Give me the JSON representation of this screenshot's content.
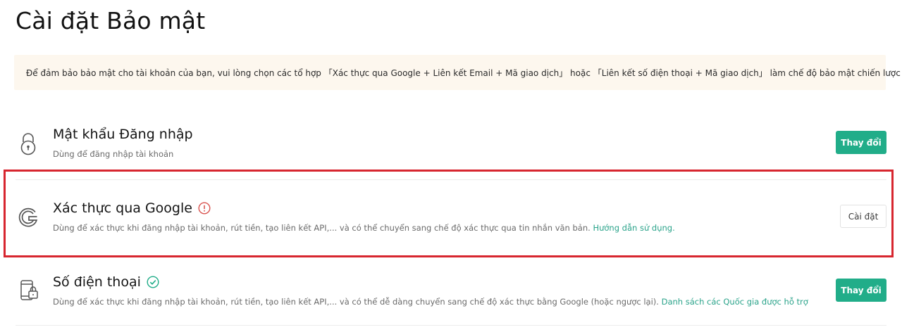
{
  "page": {
    "title": "Cài đặt Bảo mật",
    "notice": "Để đảm bảo bảo mật cho tài khoản của bạn, vui lòng chọn các tổ hợp 「Xác thực qua Google + Liên kết Email + Mã giao dịch」 hoặc 「Liên kết số điện thoại + Mã giao dịch」 làm chế độ bảo mật chiến lược của bạn."
  },
  "items": [
    {
      "title": "Mật khẩu Đăng nhập",
      "desc": "Dùng để đăng nhập tài khoản",
      "button": "Thay đổi",
      "icon": "lock-icon"
    },
    {
      "title": "Xác thực qua Google",
      "desc": "Dùng để xác thực khi đăng nhập tài khoản, rút tiền, tạo liên kết API,... và có thể chuyển sang chế độ xác thực qua tin nhắn văn bản.",
      "link": "Hướng dẫn sử dụng.",
      "button": "Cài đặt",
      "icon": "google-icon",
      "status_icon": "warning-icon"
    },
    {
      "title": "Số điện thoại",
      "desc": "Dùng để xác thực khi đăng nhập tài khoản, rút tiền, tạo liên kết API,... và có thể dễ dàng chuyển sang chế độ xác thực bằng Google (hoặc ngược lại).",
      "link": "Danh sách các Quốc gia được hỗ trợ",
      "button": "Thay đổi",
      "icon": "phone-lock-icon",
      "status_icon": "check-icon"
    }
  ],
  "colors": {
    "accent": "#21ad89",
    "link": "#2aa38a",
    "warning": "#d9534f",
    "notice_bg": "#fdf7ee",
    "highlight": "#d7262f"
  }
}
